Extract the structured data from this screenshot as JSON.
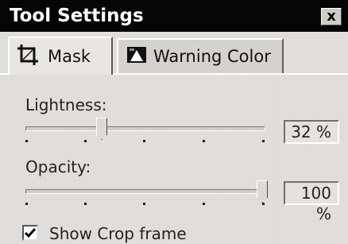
{
  "window": {
    "title": "Tool Settings",
    "close_label": "x"
  },
  "tabs": [
    {
      "label": "Mask",
      "icon": "crop-icon",
      "selected": true
    },
    {
      "label": "Warning Color",
      "icon": "warning-color-icon",
      "selected": false
    }
  ],
  "lightness": {
    "label": "Lightness:",
    "value_text": "32 %",
    "value": 32
  },
  "opacity": {
    "label": "Opacity:",
    "value_text": "100 %",
    "value": 100
  },
  "show_crop_frame": {
    "label": "Show Crop frame",
    "checked": true
  },
  "colors": {
    "titlebar": "#050505",
    "panel": "#e0dfdd"
  }
}
